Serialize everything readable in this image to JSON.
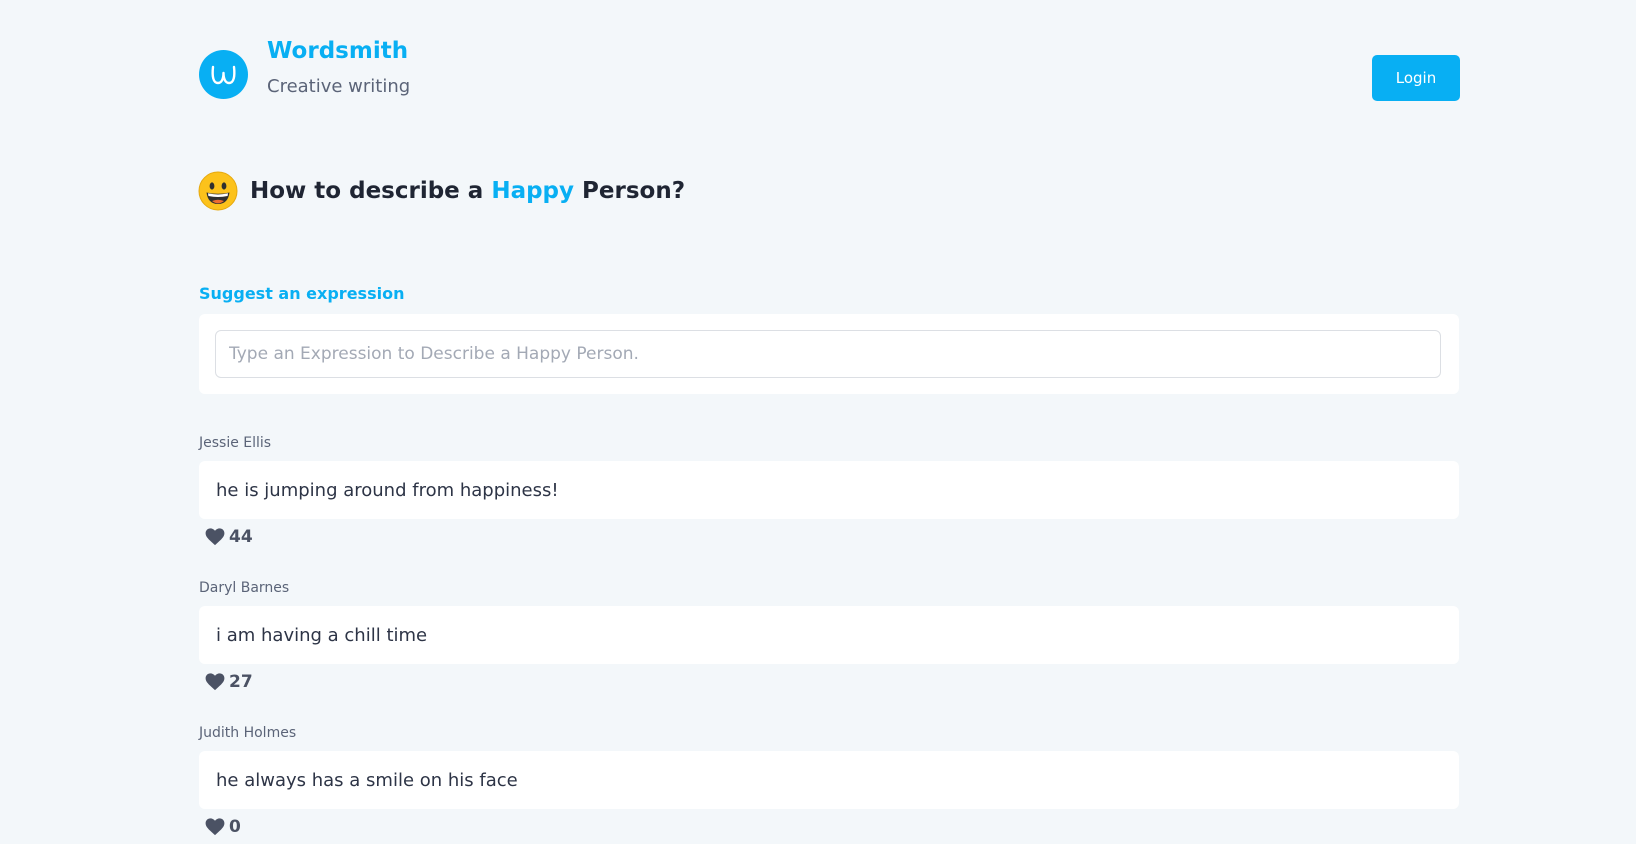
{
  "brand": {
    "name": "Wordsmith",
    "tagline": "Creative writing",
    "logo_letter": "w",
    "accent_color": "#08aff3"
  },
  "header": {
    "login_label": "Login"
  },
  "page": {
    "emoji_icon": "grinning-face-icon",
    "title_prefix": "How to describe a ",
    "title_highlight": "Happy",
    "title_suffix": " Person?"
  },
  "suggest": {
    "label": "Suggest an expression",
    "placeholder": "Type an Expression to Describe a Happy Person.",
    "value": ""
  },
  "entries": [
    {
      "author": "Jessie Ellis",
      "text": "he is jumping around from happiness!",
      "likes": "44",
      "icon": "heart-icon"
    },
    {
      "author": "Daryl Barnes",
      "text": "i am having a chill time",
      "likes": "27",
      "icon": "heart-icon"
    },
    {
      "author": "Judith Holmes",
      "text": "he always has a smile on his face",
      "likes": "0",
      "icon": "heart-icon"
    }
  ]
}
